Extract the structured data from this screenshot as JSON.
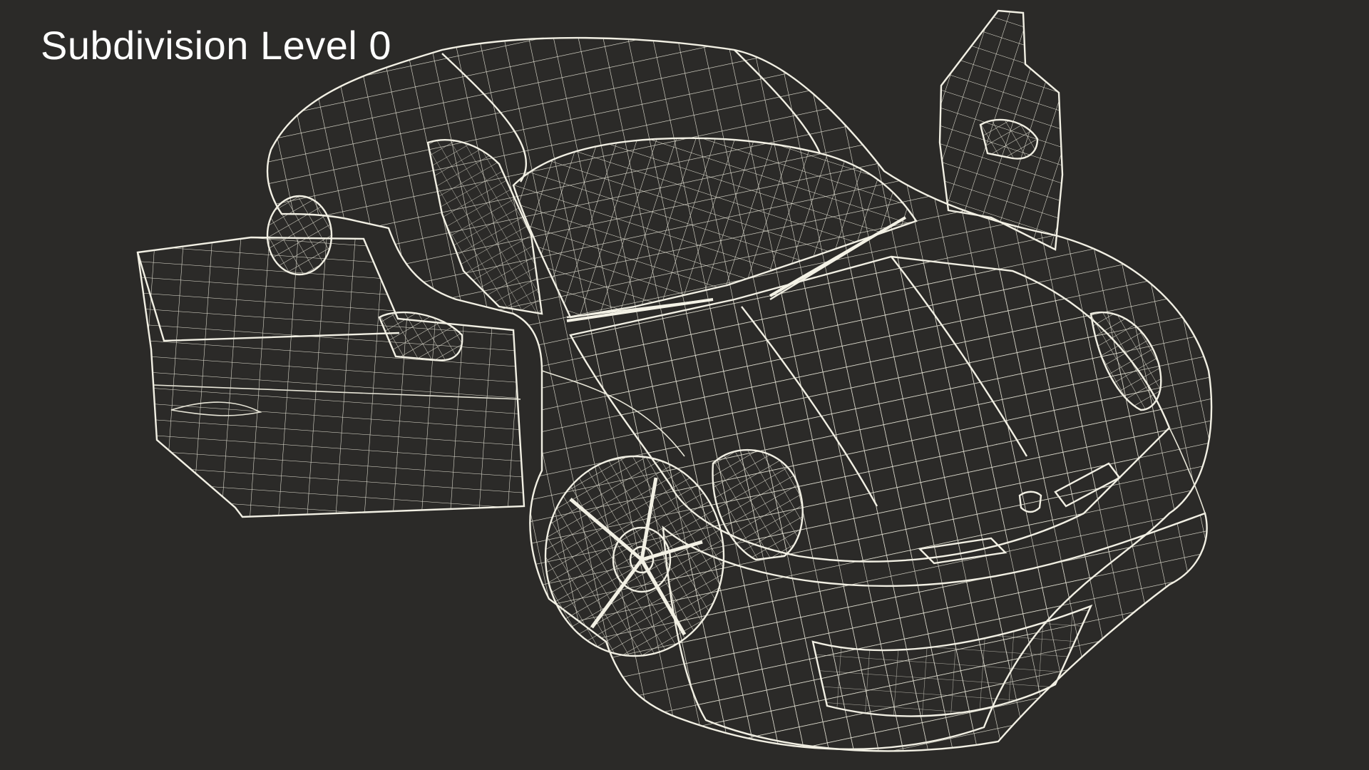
{
  "caption": "Subdivision Level 0",
  "colors": {
    "background": "#2b2a28",
    "surface": "#7d7c6c",
    "surface_dark": "#5f5e52",
    "wire": "#e8e6d8",
    "caption_text": "#ffffff"
  },
  "image_subject": "wireframe-sports-car-render"
}
